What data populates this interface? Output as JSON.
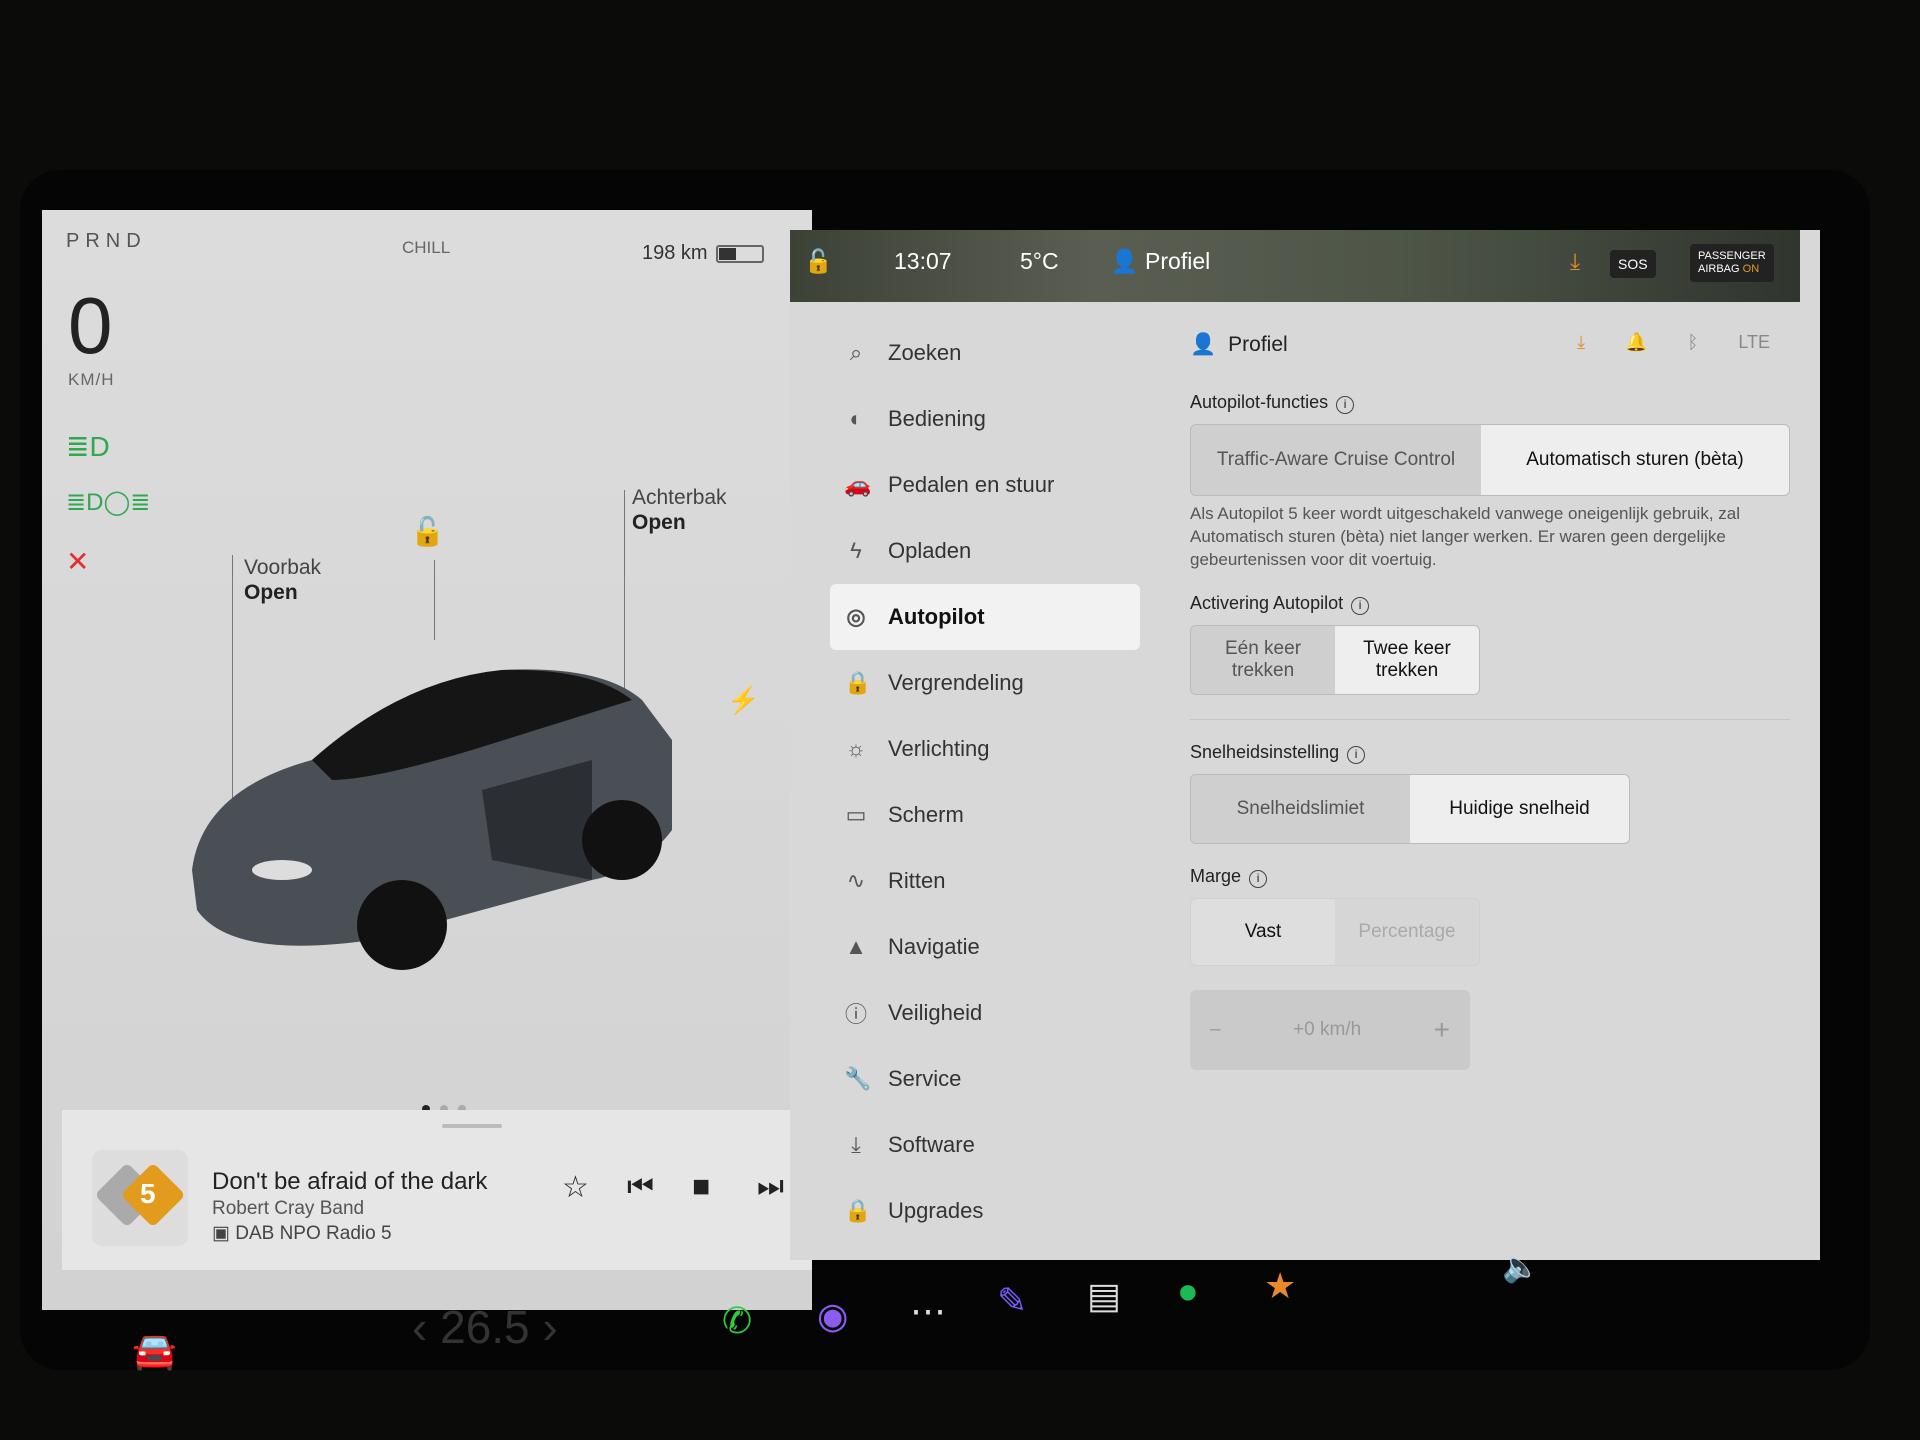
{
  "left_panel": {
    "gear": "PRND",
    "drive_mode": "CHILL",
    "range": "198 km",
    "battery_percent": 40,
    "speed": "0",
    "speed_unit": "KM/H",
    "frunk": {
      "label": "Voorbak",
      "status": "Open"
    },
    "trunk": {
      "label": "Achterbak",
      "status": "Open"
    },
    "page_dots": 3,
    "active_page": 1
  },
  "media": {
    "song": "Don't be afraid of the dark",
    "artist": "Robert Cray Band",
    "source": "DAB NPO Radio 5",
    "logo_text": "npo radio 5"
  },
  "top_bar": {
    "time": "13:07",
    "temperature": "5°C",
    "profile": "Profiel",
    "sos": "SOS",
    "airbag_line1": "PASSENGER",
    "airbag_line2": "AIRBAG",
    "airbag_state": "ON"
  },
  "nav": {
    "items": [
      {
        "label": "Zoeken",
        "icon": "search"
      },
      {
        "label": "Bediening",
        "icon": "toggle"
      },
      {
        "label": "Pedalen en stuur",
        "icon": "car"
      },
      {
        "label": "Opladen",
        "icon": "bolt"
      },
      {
        "label": "Autopilot",
        "icon": "steering-wheel",
        "active": true
      },
      {
        "label": "Vergrendeling",
        "icon": "lock"
      },
      {
        "label": "Verlichting",
        "icon": "sun"
      },
      {
        "label": "Scherm",
        "icon": "display"
      },
      {
        "label": "Ritten",
        "icon": "trips"
      },
      {
        "label": "Navigatie",
        "icon": "navigation"
      },
      {
        "label": "Veiligheid",
        "icon": "alert"
      },
      {
        "label": "Service",
        "icon": "wrench"
      },
      {
        "label": "Software",
        "icon": "download"
      },
      {
        "label": "Upgrades",
        "icon": "bag"
      }
    ]
  },
  "settings": {
    "profile": "Profiel",
    "autopilot_features": {
      "title": "Autopilot-functies",
      "options": [
        "Traffic-Aware Cruise Control",
        "Automatisch sturen (bèta)"
      ],
      "selected": 1,
      "description": "Als Autopilot 5 keer wordt uitgeschakeld vanwege oneigenlijk gebruik, zal Automatisch sturen (bèta) niet langer werken. Er waren geen dergelijke gebeurtenissen voor dit voertuig."
    },
    "activation": {
      "title": "Activering Autopilot",
      "options": [
        "Eén keer trekken",
        "Twee keer trekken"
      ],
      "selected": 1
    },
    "speed_setting": {
      "title": "Snelheidsinstelling",
      "options": [
        "Snelheidslimiet",
        "Huidige snelheid"
      ],
      "selected": 1
    },
    "margin": {
      "title": "Marge",
      "options": [
        "Vast",
        "Percentage"
      ],
      "selected": 0,
      "value": "+0 km/h",
      "minus": "–",
      "plus": "+"
    }
  },
  "taskbar": {
    "temperature": "26.5"
  },
  "colors": {
    "download": "#e8892a",
    "phone": "#2ecc40",
    "spotify": "#1db954",
    "warning": "#e03030",
    "lights": "#2fa84f"
  }
}
